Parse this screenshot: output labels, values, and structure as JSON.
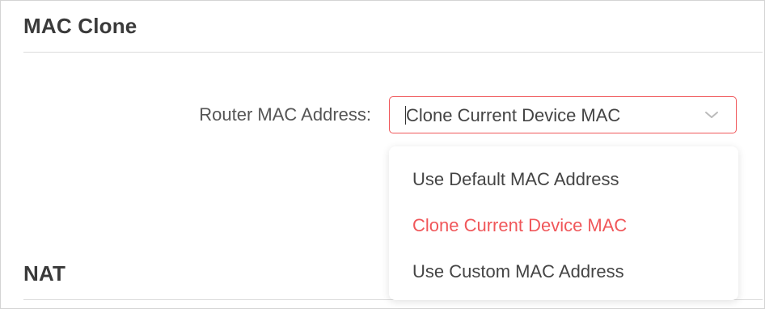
{
  "sections": {
    "mac_clone_title": "MAC Clone",
    "nat_title": "NAT"
  },
  "router_mac": {
    "label": "Router MAC Address:",
    "selected_value": "Clone Current Device MAC",
    "options": [
      {
        "label": "Use Default MAC Address",
        "selected": false
      },
      {
        "label": "Clone Current Device MAC",
        "selected": true
      },
      {
        "label": "Use Custom MAC Address",
        "selected": false
      }
    ],
    "dropdown_open": true
  },
  "colors": {
    "accent": "#f0575a",
    "text": "#444444",
    "heading": "#3a3a3a",
    "divider": "#dcdcdc"
  },
  "icons": {
    "select_chevron": "chevron-down-icon"
  }
}
